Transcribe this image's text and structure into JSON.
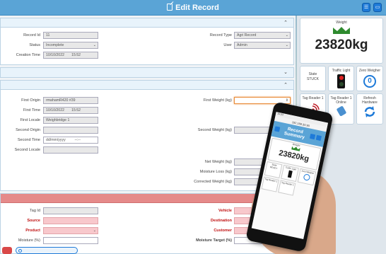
{
  "header": {
    "title": "Edit Record"
  },
  "record": {
    "id_label": "Record Id",
    "id_value": "11",
    "type_label": "Record Type",
    "type_value": "Agri Record",
    "status_label": "Status",
    "status_value": "Incomplete",
    "user_label": "User",
    "user_value": "Admin",
    "creation_label": "Creation Time",
    "creation_date": "10/10/2022",
    "creation_time": "15:52"
  },
  "weighing": {
    "first_origin_label": "First Origin",
    "first_origin_value": "rmahamR420 #39",
    "first_time_label": "First Time",
    "first_time_date": "10/10/2022",
    "first_time_time": "15:52",
    "first_locale_label": "First Locale",
    "first_locale_value": "Weighbridge 1",
    "first_weight_label": "First Weight (kg)",
    "second_origin_label": "Second Origin",
    "second_time_label": "Second Time",
    "second_time_date": "dd/mm/yyyy",
    "second_time_time": "--:--",
    "second_locale_label": "Second Locale",
    "second_weight_label": "Second Weight (kg)",
    "net_weight_label": "Net Weight (kg)",
    "moisture_loss_label": "Moisture Loss (kg)",
    "corrected_weight_label": "Corrected Weight (kg)"
  },
  "details": {
    "tag_id_label": "Tag Id",
    "vehicle_label": "Vehicle",
    "source_label": "Source",
    "destination_label": "Destination",
    "product_label": "Product",
    "customer_label": "Customer",
    "moisture_label": "Moisture (%)",
    "moisture_target_label": "Moisture Target (%)"
  },
  "sidebar": {
    "weight_label": "Weight",
    "weight_value": "23820kg",
    "state_label": "State",
    "state_value": "STUCK",
    "traffic_label": "Traffic Light",
    "zero_label": "Zero Weigher",
    "tag_reader_1_label": "Tag Reader 1",
    "tag_reader_1_online_label": "Tag Reader 1",
    "tag_reader_1_online_value": "Online",
    "refresh_label": "Refresh",
    "refresh_value": "Hardware"
  },
  "phone": {
    "status_time": "16:53",
    "url": "192.168.30.90",
    "title": "Record Summary",
    "weight_label": "Weight",
    "weight_value": "23820kg",
    "state_label": "State",
    "state_value": "READY",
    "traffic_label": "Traffic Light",
    "zero_label": "Zero Weigher",
    "tag_reader_label": "Tag Reader 1",
    "tag_reader_2_label": "Tag Reader 1"
  },
  "colors": {
    "header": "#5aa4d6",
    "pink": "#f8c8cc",
    "red_header": "#e58a8a",
    "weight_logo": "#2e8a2e"
  }
}
